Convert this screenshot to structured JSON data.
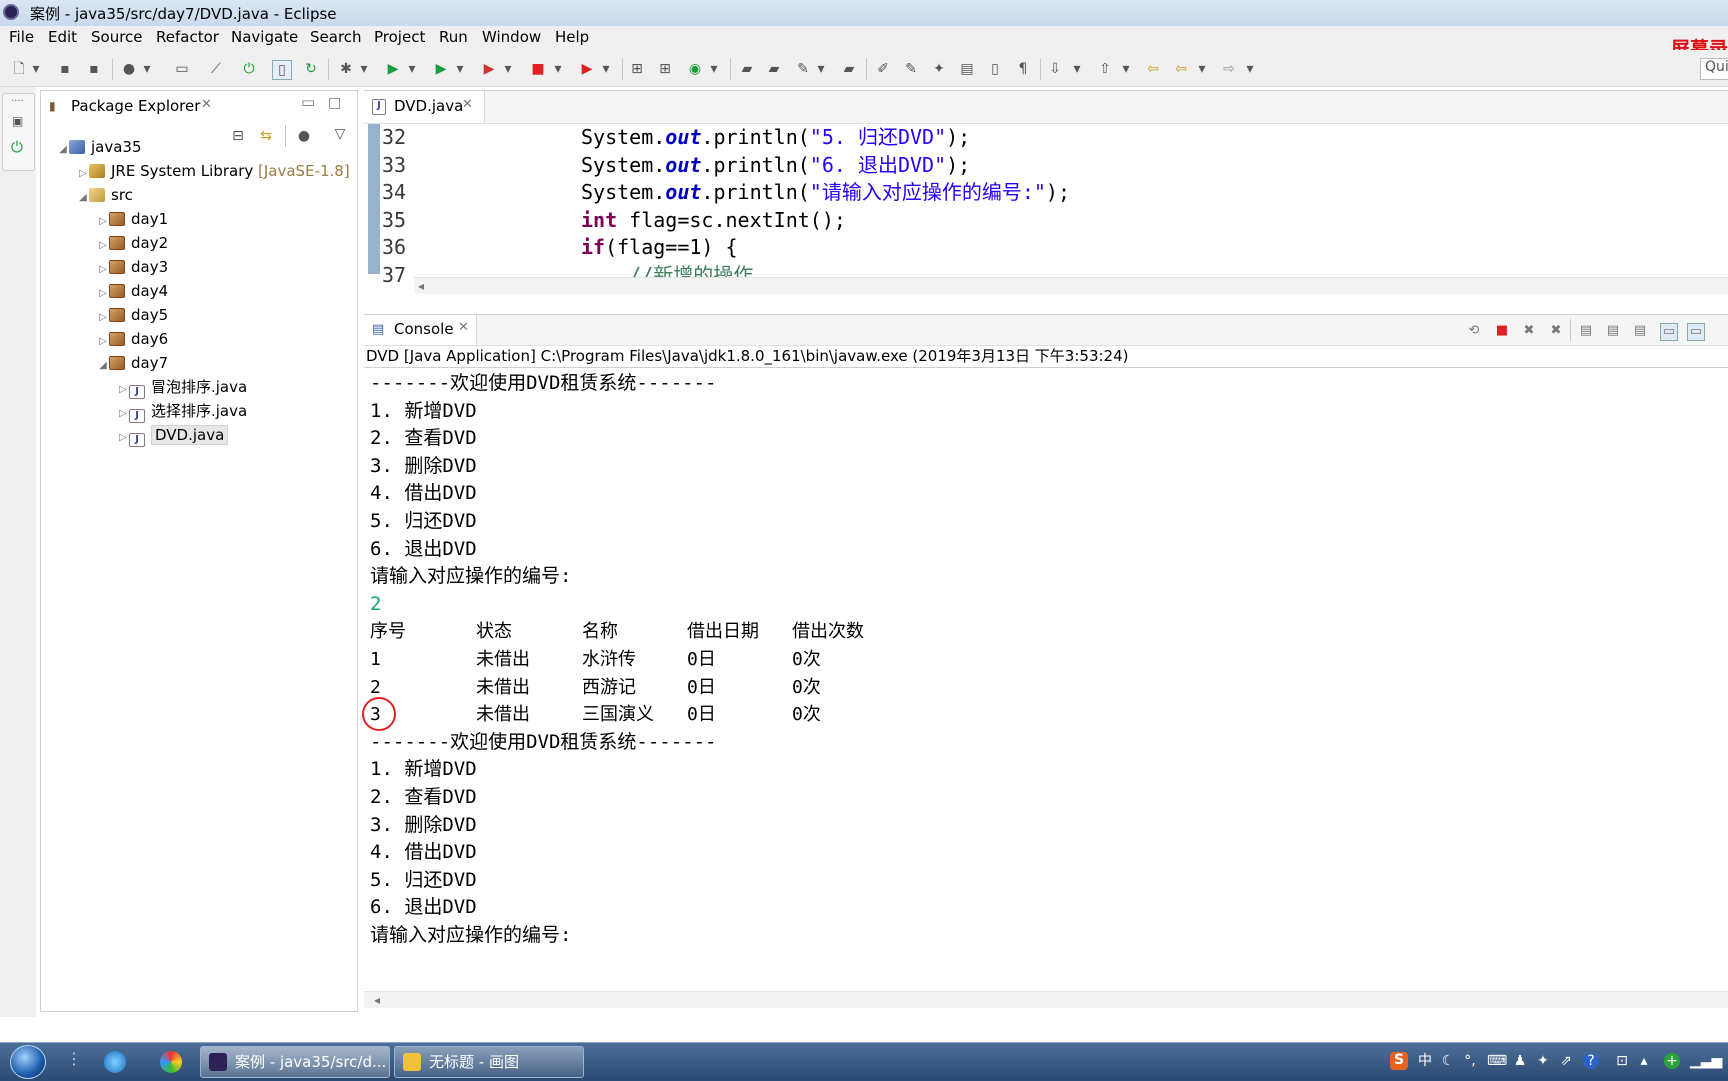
{
  "window": {
    "title": "案例 - java35/src/day7/DVD.java - Eclipse"
  },
  "menu": [
    "File",
    "Edit",
    "Source",
    "Refactor",
    "Navigate",
    "Search",
    "Project",
    "Run",
    "Window",
    "Help"
  ],
  "recorder_label": "屏幕录",
  "quick_access": "Quic",
  "explorer": {
    "title": "Package Explorer",
    "tree": [
      {
        "label": "java35",
        "level": 0,
        "icon": "project-icon",
        "expanded": true
      },
      {
        "label": "JRE System Library",
        "suffix": "[JavaSE-1.8]",
        "level": 1,
        "icon": "library-icon",
        "expanded": false
      },
      {
        "label": "src",
        "level": 1,
        "icon": "source-folder-icon",
        "expanded": true
      },
      {
        "label": "day1",
        "level": 2,
        "icon": "package-icon",
        "expanded": false
      },
      {
        "label": "day2",
        "level": 2,
        "icon": "package-icon",
        "expanded": false
      },
      {
        "label": "day3",
        "level": 2,
        "icon": "package-icon",
        "expanded": false
      },
      {
        "label": "day4",
        "level": 2,
        "icon": "package-icon",
        "expanded": false
      },
      {
        "label": "day5",
        "level": 2,
        "icon": "package-icon",
        "expanded": false
      },
      {
        "label": "day6",
        "level": 2,
        "icon": "package-icon",
        "expanded": false
      },
      {
        "label": "day7",
        "level": 2,
        "icon": "package-icon",
        "expanded": true
      },
      {
        "label": "冒泡排序.java",
        "level": 3,
        "icon": "java-file-icon",
        "expanded": false
      },
      {
        "label": "选择排序.java",
        "level": 3,
        "icon": "java-file-icon",
        "expanded": false
      },
      {
        "label": "DVD.java",
        "level": 3,
        "icon": "java-file-icon",
        "expanded": false,
        "selected": true
      }
    ]
  },
  "editor": {
    "tab": "DVD.java",
    "lines": [
      {
        "num": "32",
        "indent": "",
        "tokens": [
          [
            "plain",
            "System."
          ],
          [
            "fld",
            "out"
          ],
          [
            "plain",
            ".println("
          ],
          [
            "str",
            "\"5. 归还DVD\""
          ],
          [
            "plain",
            ");"
          ]
        ]
      },
      {
        "num": "33",
        "indent": "",
        "tokens": [
          [
            "plain",
            "System."
          ],
          [
            "fld",
            "out"
          ],
          [
            "plain",
            ".println("
          ],
          [
            "str",
            "\"6. 退出DVD\""
          ],
          [
            "plain",
            ");"
          ]
        ]
      },
      {
        "num": "34",
        "indent": "",
        "tokens": [
          [
            "plain",
            "System."
          ],
          [
            "fld",
            "out"
          ],
          [
            "plain",
            ".println("
          ],
          [
            "str",
            "\"请输入对应操作的编号:\""
          ],
          [
            "plain",
            ");"
          ]
        ]
      },
      {
        "num": "35",
        "indent": "",
        "tokens": [
          [
            "kw",
            "int"
          ],
          [
            "plain",
            " flag=sc.nextInt();"
          ]
        ]
      },
      {
        "num": "36",
        "indent": "",
        "tokens": [
          [
            "kw",
            "if"
          ],
          [
            "plain",
            "(flag==1) {"
          ]
        ]
      },
      {
        "num": "37",
        "indent": "    ",
        "tokens": [
          [
            "cmt",
            "//新增的操作"
          ]
        ]
      }
    ]
  },
  "console": {
    "tab": "Console",
    "description": "DVD [Java Application] C:\\Program Files\\Java\\jdk1.8.0_161\\bin\\javaw.exe (2019年3月13日 下午3:53:24)",
    "menu_lines_1": [
      "-------欢迎使用DVD租赁系统-------",
      "1. 新增DVD",
      "2. 查看DVD",
      "3. 删除DVD",
      "4. 借出DVD",
      "5. 归还DVD",
      "6. 退出DVD",
      "请输入对应操作的编号:"
    ],
    "user_input": "2",
    "table_headers": [
      "序号",
      "状态",
      "名称",
      "借出日期",
      "借出次数"
    ],
    "table_rows": [
      [
        "1",
        "未借出",
        "水浒传",
        "0日",
        "0次"
      ],
      [
        "2",
        "未借出",
        "西游记",
        "0日",
        "0次"
      ],
      [
        "3",
        "未借出",
        "三国演义",
        "0日",
        "0次"
      ]
    ],
    "menu_lines_2": [
      "-------欢迎使用DVD租赁系统-------",
      "1. 新增DVD",
      "2. 查看DVD",
      "3. 删除DVD",
      "4. 借出DVD",
      "5. 归还DVD",
      "6. 退出DVD",
      "请输入对应操作的编号:"
    ]
  },
  "taskbar": {
    "buttons": [
      {
        "label": "案例 - java35/src/d...",
        "icon": "eclipse-icon",
        "active": true
      },
      {
        "label": "无标题 - 画图",
        "icon": "paint-icon",
        "active": false
      }
    ],
    "tray_input": "中"
  }
}
